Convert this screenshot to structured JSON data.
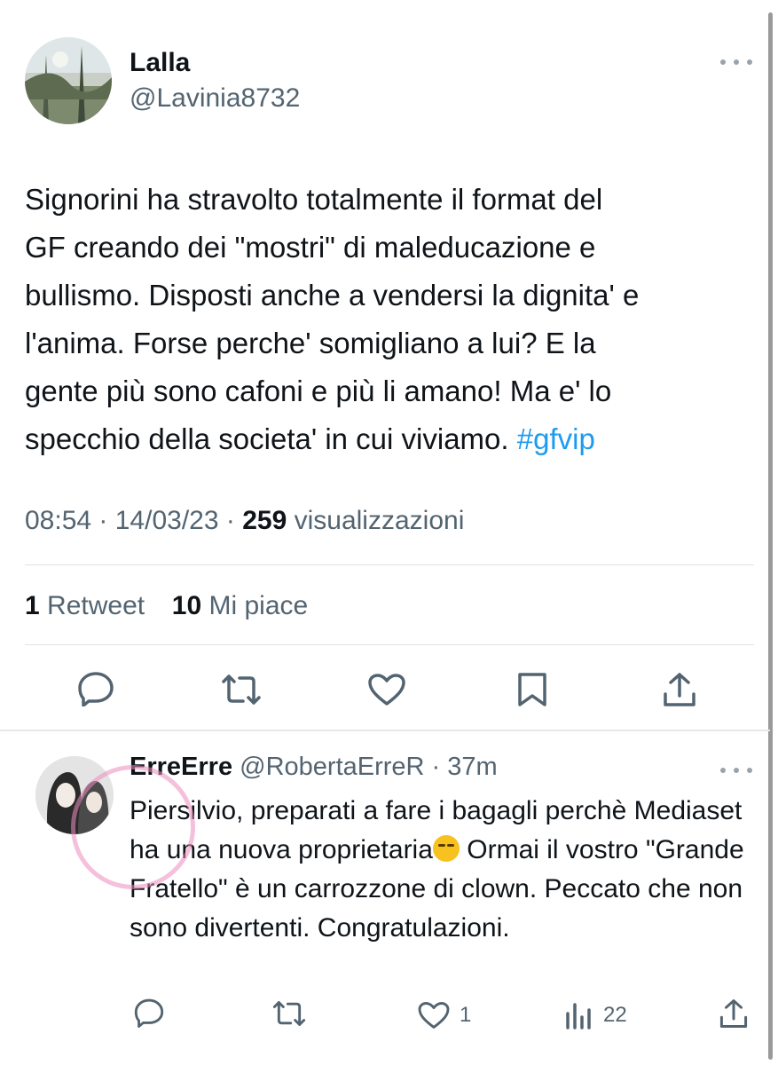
{
  "tweet": {
    "author_name": "Lalla",
    "author_handle": "@Lavinia8732",
    "text_lines": [
      "Signorini ha stravolto totalmente il format del",
      "GF creando dei \"mostri\" di maleducazione e",
      "bullismo. Disposti anche a vendersi la dignita' e",
      "l'anima. Forse perche' somigliano a lui? E la",
      "gente più sono cafoni e più li amano! Ma e' lo",
      "specchio della societa' in cui viviamo. "
    ],
    "hashtag": "#gfvip",
    "time": "08:54",
    "date": "14/03/23",
    "views_count": "259",
    "views_label": "visualizzazioni",
    "retweet_count": "1",
    "retweet_label": "Retweet",
    "likes_count": "10",
    "likes_label": "Mi piace"
  },
  "reply": {
    "author_name": "ErreErre",
    "author_handle": "@RobertaErreR",
    "time_ago": "37m",
    "text_before_emoji": "Piersilvio, preparati a fare i bagagli perchè Mediaset ha una nuova proprietaria",
    "text_after_emoji": " Ormai il vostro \"Grande Fratello\" è un carrozzone di clown. Peccato che non sono divertenti. Congratulazioni.",
    "like_count": "1",
    "views_count": "22"
  },
  "icons": {
    "reply": "reply-icon",
    "retweet": "retweet-icon",
    "like": "heart-icon",
    "bookmark": "bookmark-icon",
    "share": "share-icon",
    "views": "views-icon",
    "more": "more-icon"
  },
  "colors": {
    "link": "#1d9bf0",
    "secondary_text": "#536471",
    "primary_text": "#0f1419"
  }
}
